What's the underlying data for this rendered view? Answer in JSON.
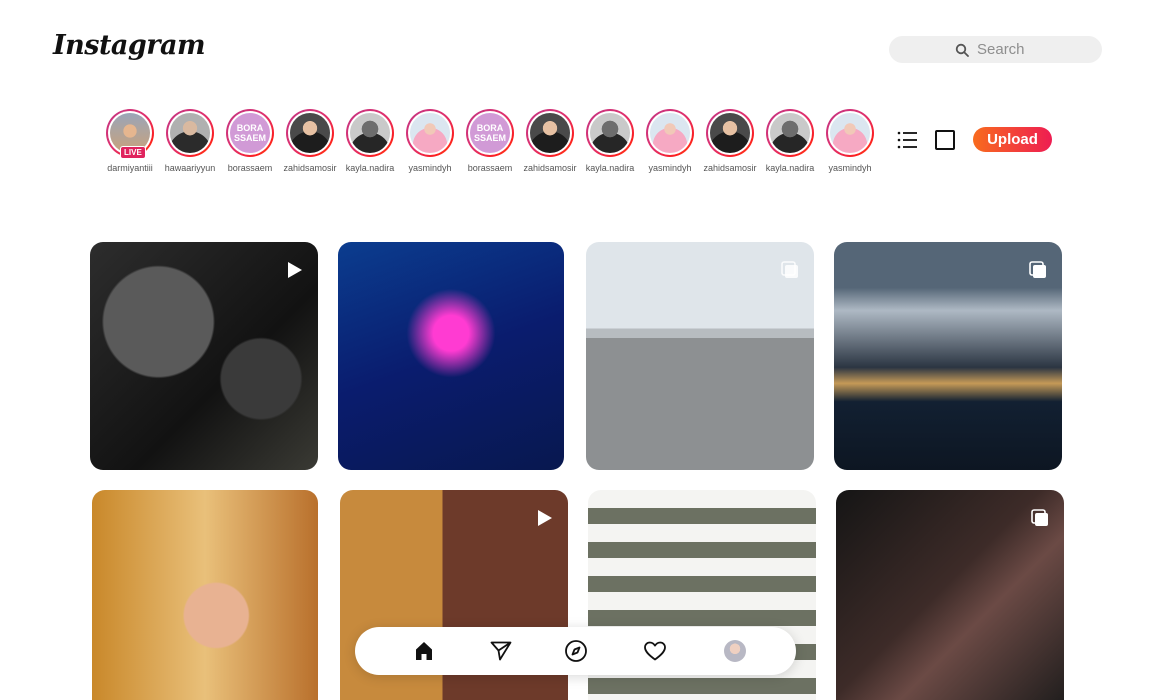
{
  "app": {
    "logo_text": "Instagram"
  },
  "search": {
    "placeholder": "Search"
  },
  "stories": [
    {
      "username": "darmiyantiii",
      "live": true,
      "live_label": "LIVE",
      "avatar": "landscape"
    },
    {
      "username": "hawaariyyun",
      "live": false,
      "avatar": "man-grey"
    },
    {
      "username": "borassaem",
      "live": false,
      "avatar": "bora",
      "avatar_text": "BORA SSAEM"
    },
    {
      "username": "zahidsamosir",
      "live": false,
      "avatar": "man"
    },
    {
      "username": "kayla.nadira",
      "live": false,
      "avatar": "helmet"
    },
    {
      "username": "yasmindyh",
      "live": false,
      "avatar": "pink-hijab"
    },
    {
      "username": "borassaem",
      "live": false,
      "avatar": "bora",
      "avatar_text": "BORA SSAEM"
    },
    {
      "username": "zahidsamosir",
      "live": false,
      "avatar": "man"
    },
    {
      "username": "kayla.nadira",
      "live": false,
      "avatar": "helmet"
    },
    {
      "username": "yasmindyh",
      "live": false,
      "avatar": "pink-hijab"
    },
    {
      "username": "zahidsamosir",
      "live": false,
      "avatar": "man"
    },
    {
      "username": "kayla.nadira",
      "live": false,
      "avatar": "helmet"
    },
    {
      "username": "yasmindyh",
      "live": false,
      "avatar": "pink-hijab"
    }
  ],
  "toolbar": {
    "upload_label": "Upload",
    "list_view_icon": "list-icon",
    "grid_view_icon": "square-icon"
  },
  "posts": [
    {
      "subject": "camera gear on backpack",
      "type": "video"
    },
    {
      "subject": "neon wall mural",
      "type": "photo"
    },
    {
      "subject": "woman with shopping cart",
      "type": "carousel"
    },
    {
      "subject": "mountain lake village",
      "type": "carousel"
    },
    {
      "subject": "children hugging",
      "type": "photo"
    },
    {
      "subject": "brick buildings",
      "type": "video"
    },
    {
      "subject": "apartment balconies",
      "type": "photo"
    },
    {
      "subject": "american flag",
      "type": "carousel"
    }
  ],
  "bottom_nav": [
    {
      "icon": "home-icon"
    },
    {
      "icon": "send-icon"
    },
    {
      "icon": "explore-compass-icon"
    },
    {
      "icon": "heart-icon"
    },
    {
      "icon": "profile-avatar"
    }
  ]
}
